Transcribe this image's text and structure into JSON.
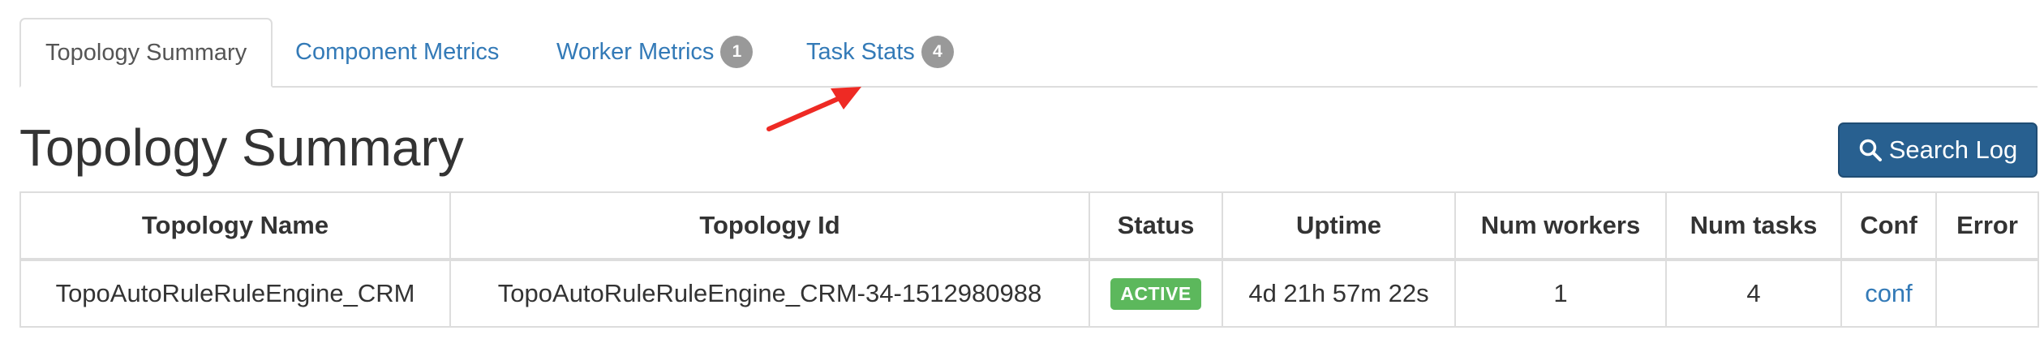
{
  "tabs": [
    {
      "label": "Topology Summary",
      "active": true,
      "badge": null
    },
    {
      "label": "Component Metrics",
      "active": false,
      "badge": null
    },
    {
      "label": "Worker Metrics",
      "active": false,
      "badge": "1"
    },
    {
      "label": "Task Stats",
      "active": false,
      "badge": "4"
    }
  ],
  "page_title": "Topology Summary",
  "search_button": {
    "label": "Search Log",
    "icon": "search-icon"
  },
  "table": {
    "headers": [
      "Topology Name",
      "Topology Id",
      "Status",
      "Uptime",
      "Num workers",
      "Num tasks",
      "Conf",
      "Error"
    ],
    "row": {
      "name": "TopoAutoRuleRuleEngine_CRM",
      "id": "TopoAutoRuleRuleEngine_CRM-34-1512980988",
      "status": "ACTIVE",
      "uptime": "4d 21h 57m 22s",
      "num_workers": "1",
      "num_tasks": "4",
      "conf": "conf",
      "error": ""
    }
  },
  "colors": {
    "link": "#337ab7",
    "primary_button": "#286090",
    "status_active": "#5cb85c",
    "badge": "#999999",
    "annotation": "#ee2a24"
  }
}
